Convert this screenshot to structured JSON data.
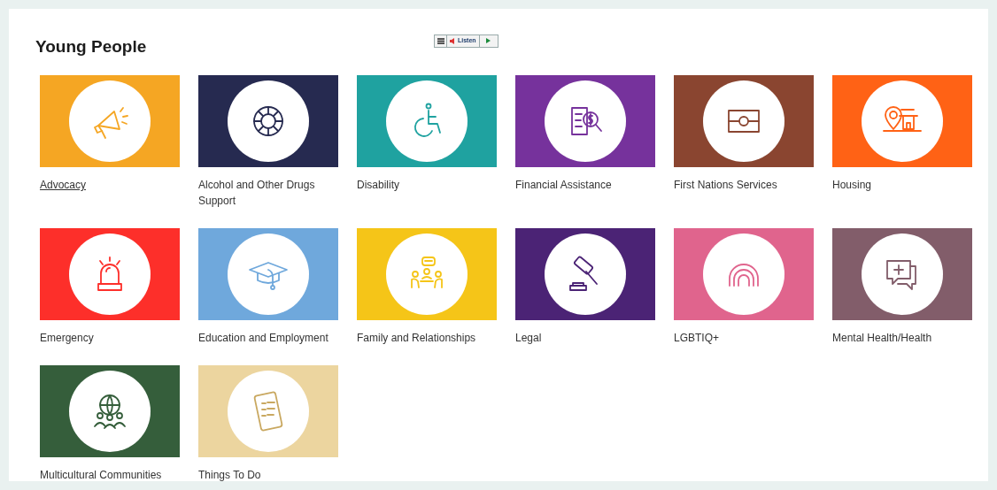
{
  "heading": "Young People",
  "listen": {
    "label": "Listen"
  },
  "categories": [
    {
      "label": "Advocacy",
      "color": "#f5a623",
      "hovered": true
    },
    {
      "label": "Alcohol and Other Drugs Support",
      "color": "#262a50",
      "hovered": false
    },
    {
      "label": "Disability",
      "color": "#1fa2a0",
      "hovered": false
    },
    {
      "label": "Financial Assistance",
      "color": "#76329c",
      "hovered": false
    },
    {
      "label": "First Nations Services",
      "color": "#8a4530",
      "hovered": false
    },
    {
      "label": "Housing",
      "color": "#ff6215",
      "hovered": false
    },
    {
      "label": "Emergency",
      "color": "#fd2f2a",
      "hovered": false
    },
    {
      "label": "Education and Employment",
      "color": "#6fa8dc",
      "hovered": false
    },
    {
      "label": "Family and Relationships",
      "color": "#f5c518",
      "hovered": false
    },
    {
      "label": "Legal",
      "color": "#4b2375",
      "hovered": false
    },
    {
      "label": "LGBTIQ+",
      "color": "#e0648d",
      "hovered": false
    },
    {
      "label": "Mental Health/Health",
      "color": "#825d6a",
      "hovered": false
    },
    {
      "label": "Multicultural Communities",
      "color": "#355e3b",
      "hovered": false
    },
    {
      "label": "Things To Do",
      "color": "#ecd59f",
      "hovered": false
    }
  ]
}
